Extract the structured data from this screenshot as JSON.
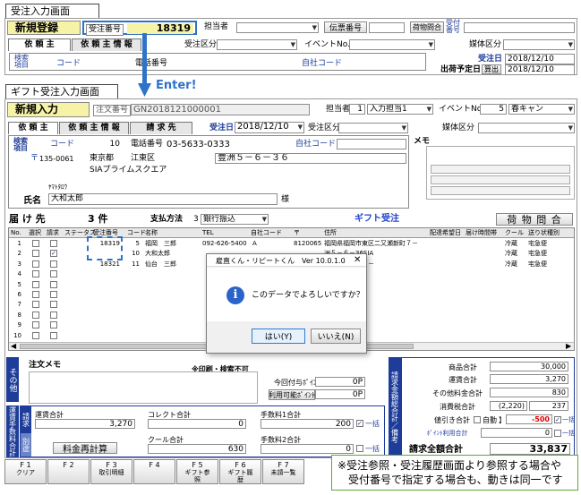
{
  "label_top": "受注入力画面",
  "label_second": "ギフト受注入力画面",
  "enter_label": "Enter!",
  "top_window": {
    "mode": "新規登録",
    "order_no_label": "受注番号",
    "order_no_value": "18319",
    "tanto_label": "担当者",
    "denpyo_label": "伝票番号",
    "nimotsu_label": "荷物問合",
    "uketsuke_label": "受付番号",
    "tab1": "依 頼 主",
    "tab2": "依 頼 主 情 報",
    "order_kubun_label": "受注区分",
    "event_label": "イベントNo.",
    "baitai_label": "媒体区分",
    "kensaku_label": "検索項目",
    "code_label": "コード",
    "tel_label": "電話番号",
    "jisha_label": "自社コード",
    "juchu_date_label": "受注日",
    "juchu_date": "2018/12/10",
    "shukka_label": "出荷予定日",
    "sanshutsu_label": "算出",
    "shukka_date": "2018/12/10"
  },
  "gift_window": {
    "mode": "新規入力",
    "order_no_label": "注文番号",
    "order_no_value": "GN2018121000001",
    "tanto_label": "担当者",
    "tanto_no": "1",
    "tanto_value": "入力担当1",
    "event_label": "イベントNo.",
    "event_no": "5",
    "event_value": "春キャン",
    "tab1": "依 頼 主",
    "tab2": "依 頼 主 情 報",
    "tab3": "請 求 先",
    "juchu_date_label": "受注日",
    "juchu_date": "2018/12/10",
    "order_kubun_label": "受注区分",
    "baitai_label": "媒体区分",
    "kensaku_label": "検索項目",
    "code_label": "コード",
    "code_value": "10",
    "tel_label": "電話番号",
    "tel_value": "03-5633-0333",
    "jisha_label": "自社コード",
    "memo_label": "メモ",
    "postal_mark": "〒",
    "postal": "135-0061",
    "pref": "東京都",
    "city": "江東区",
    "town": "豊洲５－６－３６",
    "building": "SIAプライムスクエア",
    "kana": "ﾔﾏﾄﾀﾛｳ",
    "name_label": "氏名",
    "name_value": "大和太郎",
    "sama": "様",
    "todoke_label": "届 け 先",
    "todoke_count": "3 件",
    "payment_label": "支払方法",
    "payment_no": "3",
    "payment_value": "銀行振込",
    "gift_label": "ギフト受注",
    "nimotsu_button": "荷 物 問 合",
    "columns": [
      "No.",
      "選択",
      "請求",
      "ステータス",
      "受注番号",
      "コード",
      "名称",
      "TEL",
      "自社コード",
      "〒",
      "住所",
      "配達希望日",
      "届け時間帯",
      "クール",
      "送り状種別"
    ],
    "rows": [
      {
        "no": "1",
        "order": "18319",
        "code": "5",
        "name": "福岡　三郎",
        "tel": "092-626-5400",
        "jisha": "A",
        "zip": "8120065",
        "addr": "福岡県福岡市東区二又瀬新町７－",
        "cool": "冷蔵",
        "okuri": "宅急便",
        "seikyu": false
      },
      {
        "no": "2",
        "order": "",
        "code": "10",
        "name": "大和太郎",
        "tel": "",
        "jisha": "",
        "zip": "",
        "addr": "洲５－６－36SIA",
        "cool": "冷蔵",
        "okuri": "宅急便",
        "seikyu": true
      },
      {
        "no": "3",
        "order": "18321",
        "code": "11",
        "name": "仙台　三郎",
        "tel": "",
        "jisha": "",
        "zip": "",
        "addr": "区泉中央３－２－",
        "cool": "冷蔵",
        "okuri": "宅急便",
        "seikyu": false
      },
      {
        "no": "4",
        "order": "",
        "code": "",
        "name": "",
        "tel": "",
        "jisha": "",
        "zip": "",
        "addr": "",
        "cool": "",
        "okuri": "",
        "seikyu": false
      },
      {
        "no": "5",
        "order": "",
        "code": "",
        "name": "",
        "tel": "",
        "jisha": "",
        "zip": "",
        "addr": "",
        "cool": "",
        "okuri": "",
        "seikyu": false
      },
      {
        "no": "6",
        "order": "",
        "code": "",
        "name": "",
        "tel": "",
        "jisha": "",
        "zip": "",
        "addr": "",
        "cool": "",
        "okuri": "",
        "seikyu": false
      },
      {
        "no": "7",
        "order": "",
        "code": "",
        "name": "",
        "tel": "",
        "jisha": "",
        "zip": "",
        "addr": "",
        "cool": "",
        "okuri": "",
        "seikyu": false
      },
      {
        "no": "8",
        "order": "",
        "code": "",
        "name": "",
        "tel": "",
        "jisha": "",
        "zip": "",
        "addr": "",
        "cool": "",
        "okuri": "",
        "seikyu": false
      },
      {
        "no": "9",
        "order": "",
        "code": "",
        "name": "",
        "tel": "",
        "jisha": "",
        "zip": "",
        "addr": "",
        "cool": "",
        "okuri": "",
        "seikyu": false
      },
      {
        "no": "10",
        "order": "",
        "code": "",
        "name": "",
        "tel": "",
        "jisha": "",
        "zip": "",
        "addr": "",
        "cool": "",
        "okuri": "",
        "seikyu": false
      }
    ],
    "sonota_label": "その他",
    "chumon_memo_label": "注文メモ",
    "insatsu_label": "※印刷・検索不可",
    "konkai_point_label": "今回付与ﾎﾟｲﾝﾄ",
    "konkai_point": "0P",
    "riyo_point_label": "利用可能ﾎﾟｲﾝﾄ",
    "riyo_point": "0P",
    "unchin_side": "運賃手数料合計",
    "seikyu_side": "請求",
    "betsu_side": "別途",
    "unchin_label": "運賃合計",
    "unchin_value": "3,270",
    "collect_label": "コレクト合計",
    "collect_value": "0",
    "tesuryo1_label": "手数料1合計",
    "tesuryo1_value": "200",
    "ikkatsu": "一括",
    "cool_label": "クール合計",
    "cool_value": "630",
    "tesuryo2_label": "手数料2合計",
    "tesuryo2_value": "0",
    "saikeisan_button": "料金再計算",
    "kingaku_side": "請求金額総合計／備考",
    "shohin_label": "商品合計",
    "shohin_value": "30,000",
    "unchin2_label": "運賃合計",
    "unchin2_value": "3,270",
    "sonota_gokei_label": "その他料金合計",
    "sonota_gokei_value": "830",
    "shohizei_label": "消費税合計",
    "shohizei_paren": "(2,220)",
    "shohizei_value": "237",
    "nebiki_label": "値引き合計【",
    "jido_label": "自動",
    "nebiki_close": "】",
    "nebiki_value": "-500",
    "point_riyo_label": "ﾎﾟｲﾝﾄ利用合計",
    "point_riyo_value": "0",
    "seikyu_total_label": "請求全額合計",
    "seikyu_total_value": "33,837"
  },
  "dialog": {
    "title": "雇直くん・リピートくん　Ver 10.0.1.0",
    "message": "このデータでよろしいですか？",
    "yes": "はい(Y)",
    "no": "いいえ(N)"
  },
  "fkeys": [
    {
      "key": "F1",
      "label": "クリア"
    },
    {
      "key": "F2",
      "label": ""
    },
    {
      "key": "F3",
      "label": "取引明細"
    },
    {
      "key": "F4",
      "label": ""
    },
    {
      "key": "F5",
      "label": "ギフト参照"
    },
    {
      "key": "F6",
      "label": "ギフト履歴"
    },
    {
      "key": "F7",
      "label": "未請一覧"
    }
  ],
  "note_line1": "※受注参照・受注履歴画面より参照する場合や",
  "note_line2": "受付番号で指定する場合も、動きは同一です",
  "colors": {
    "navy": "#1e3c99",
    "yellow": "#f7f3a6",
    "arrow": "#2e73c8",
    "red": "#e00000"
  }
}
